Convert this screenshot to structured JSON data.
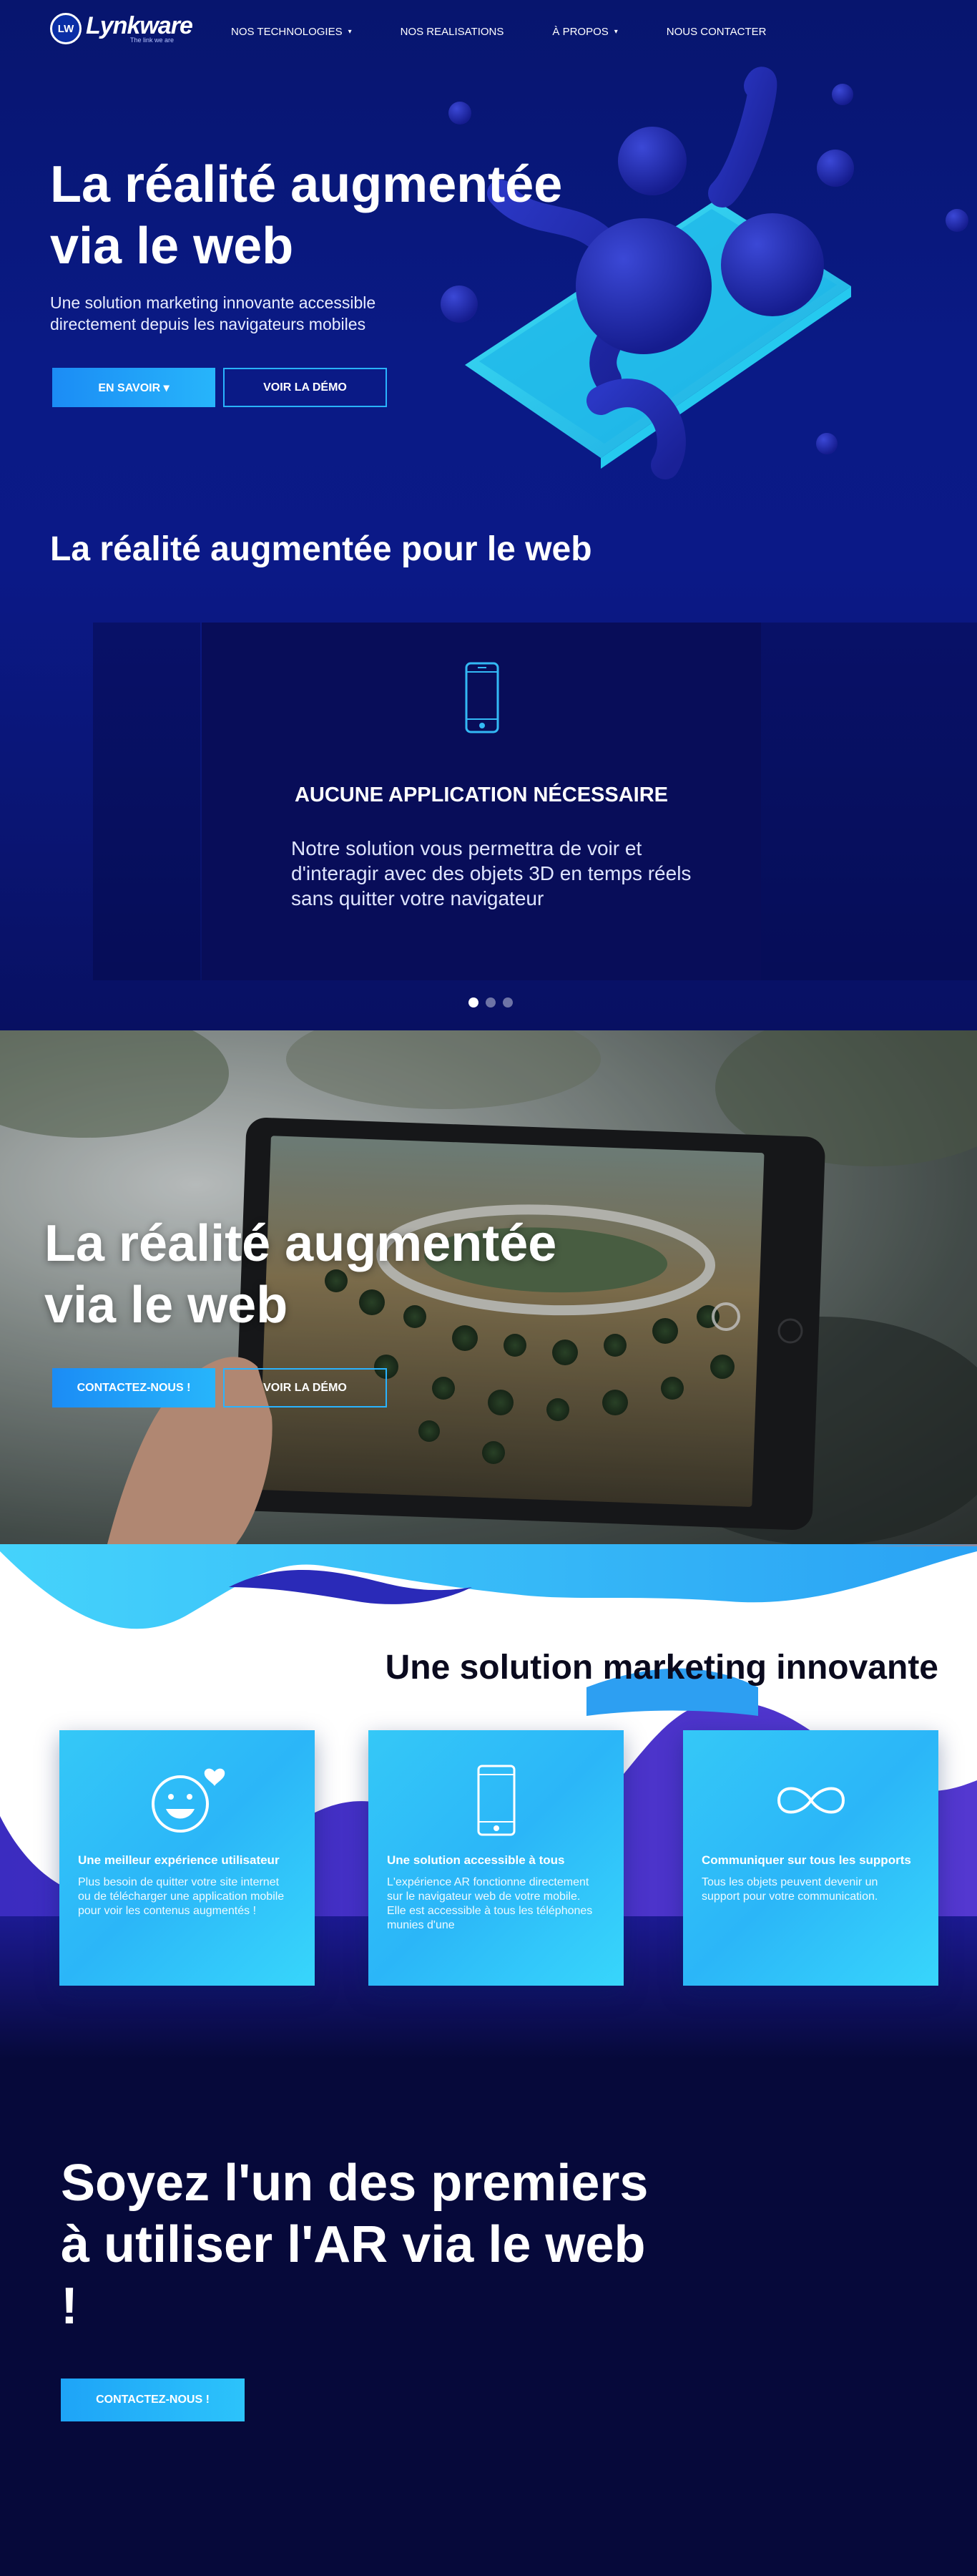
{
  "nav": {
    "logo_badge": "LW",
    "logo_name": "Lynkware",
    "logo_tagline": "The link we are",
    "items": [
      {
        "label": "NOS TECHNOLOGIES",
        "caret": "▾"
      },
      {
        "label": "NOS REALISATIONS",
        "caret": ""
      },
      {
        "label": "À PROPOS",
        "caret": "▾"
      },
      {
        "label": "NOUS CONTACTER",
        "caret": ""
      }
    ]
  },
  "hero": {
    "title": "La réalité augmentée via le web",
    "subtitle": "Une solution marketing innovante accessible directement depuis les navigateurs mobiles",
    "primary_button": "EN SAVOIR ▾",
    "secondary_button": "VOIR LA  DÉMO"
  },
  "section": {
    "title": "La réalité augmentée pour le web"
  },
  "slider": {
    "heading": "AUCUNE APPLICATION NÉCESSAIRE",
    "text": "Notre solution vous permettra de voir et d'interagir avec des objets 3D en temps réels sans quitter votre navigateur",
    "icon": "smartphone-icon",
    "dots": 3,
    "active_dot": 0
  },
  "photo": {
    "title": "La réalité augmentée via le web",
    "primary_button": "CONTACTEZ-NOUS !",
    "secondary_button": "VOIR LA  DÉMO"
  },
  "features": {
    "title": "Une solution marketing innovante",
    "cards": [
      {
        "icon": "smiley-heart-icon",
        "title": "Une meilleur expérience utilisateur",
        "text": "Plus besoin de quitter votre site internet ou de télécharger une application mobile pour voir les contenus augmentés !"
      },
      {
        "icon": "smartphone-icon",
        "title": "Une solution accessible à tous",
        "text": "L'expérience AR fonctionne directement sur le navigateur web de votre mobile. Elle est accessible à tous les téléphones munies d'une"
      },
      {
        "icon": "infinity-icon",
        "title": "Communiquer sur tous les supports",
        "text": "Tous les objets peuvent devenir un support pour votre communication."
      }
    ]
  },
  "cta": {
    "title": "Soyez l'un des premiers à utiliser l'AR via le web !",
    "button": "CONTACTEZ-NOUS !"
  },
  "colors": {
    "hero_bg": "#0a1a86",
    "accent": "#27b5fb",
    "cta_bg": "#06093a",
    "card": "#2bb6f8"
  }
}
